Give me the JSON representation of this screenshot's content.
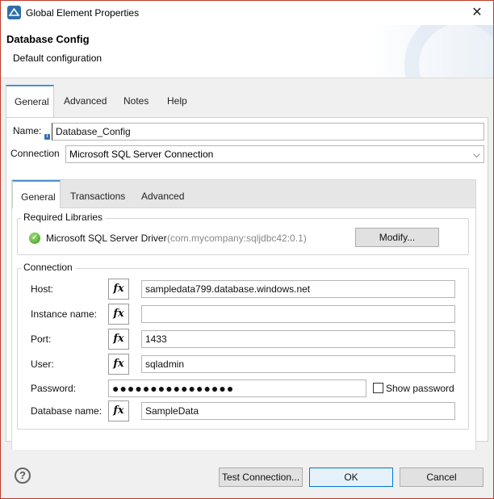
{
  "window": {
    "title": "Global Element Properties",
    "close_glyph": "✕",
    "icon": "mule-studio-icon"
  },
  "header": {
    "title": "Database Config",
    "subtitle": "Default configuration"
  },
  "tabs": [
    {
      "label": "General",
      "active": true
    },
    {
      "label": "Advanced",
      "active": false
    },
    {
      "label": "Notes",
      "active": false
    },
    {
      "label": "Help",
      "active": false
    }
  ],
  "general": {
    "name_label": "Name:",
    "name_value": "Database_Config",
    "connection_label": "Connection",
    "connection_value": "Microsoft SQL Server Connection",
    "inner_tabs": [
      {
        "label": "General",
        "active": true
      },
      {
        "label": "Transactions",
        "active": false
      },
      {
        "label": "Advanced",
        "active": false
      }
    ],
    "required_libraries": {
      "legend": "Required Libraries",
      "driver_name": "Microsoft SQL Server Driver",
      "driver_coords": "(com.mycompany:sqljdbc42:0.1)",
      "modify_label": "Modify..."
    },
    "connection_group": {
      "legend": "Connection",
      "fields": {
        "host": {
          "label": "Host:",
          "value": "sampledata799.database.windows.net"
        },
        "instance": {
          "label": "Instance name:",
          "value": ""
        },
        "port": {
          "label": "Port:",
          "value": "1433"
        },
        "user": {
          "label": "User:",
          "value": "sqladmin"
        },
        "password": {
          "label": "Password:",
          "value": "●●●●●●●●●●●●●●●●"
        },
        "database": {
          "label": "Database name:",
          "value": "SampleData"
        }
      },
      "show_password_label": "Show password",
      "fx_label": "fx"
    }
  },
  "footer": {
    "help_glyph": "?",
    "test_connection_label": "Test Connection...",
    "ok_label": "OK",
    "cancel_label": "Cancel"
  },
  "colors": {
    "accent": "#4f8fd1",
    "window_border": "#c0392b",
    "ok_green": "#3a9a1c"
  }
}
